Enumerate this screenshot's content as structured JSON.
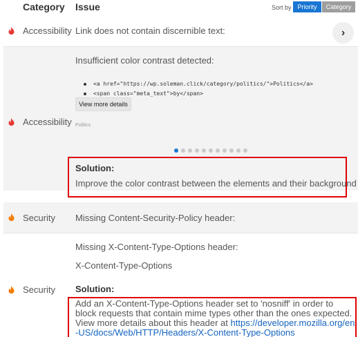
{
  "header": {
    "category_label": "Category",
    "issue_label": "Issue",
    "sort_by_label": "Sort by",
    "sort_priority": "Priority",
    "sort_category": "Category"
  },
  "issues": [
    {
      "category": "Accessibility",
      "title": "Link does not contain discernible text:",
      "severity_color": "#e53935"
    },
    {
      "category": "Accessibility",
      "title": "Insufficient color contrast detected:",
      "code_items": [
        "<a href=\"https://wp.soleman.click/category/politics/\">Politics</a>",
        "<span class=\"meta_text\">by</span>"
      ],
      "view_more_label": "View more details",
      "preview_text": "Politics",
      "carousel_count": 11,
      "carousel_active": 1,
      "solution_label": "Solution:",
      "solution_text": "Improve the color contrast between the elements and their background",
      "severity_color": "#e53935"
    },
    {
      "category": "Security",
      "title": "Missing Content-Security-Policy header:",
      "severity_color": "#f57c00"
    },
    {
      "category": "Security",
      "title": "Missing X-Content-Type-Options header:",
      "subtitle": "X-Content-Type-Options",
      "solution_label": "Solution:",
      "solution_text": "Add an X-Content-Type-Options header set to 'nosniff' in order to block requests that contain mime types other than the ones expected. View more details about this header at ",
      "solution_link": "https://developer.mozilla.org/en-US/docs/Web/HTTP/Headers/X-Content-Type-Options",
      "severity_color": "#f57c00"
    }
  ],
  "colors": {
    "accent": "#1976d2",
    "highlight_box": "#e00000",
    "row_background": "#f3f3f3"
  }
}
